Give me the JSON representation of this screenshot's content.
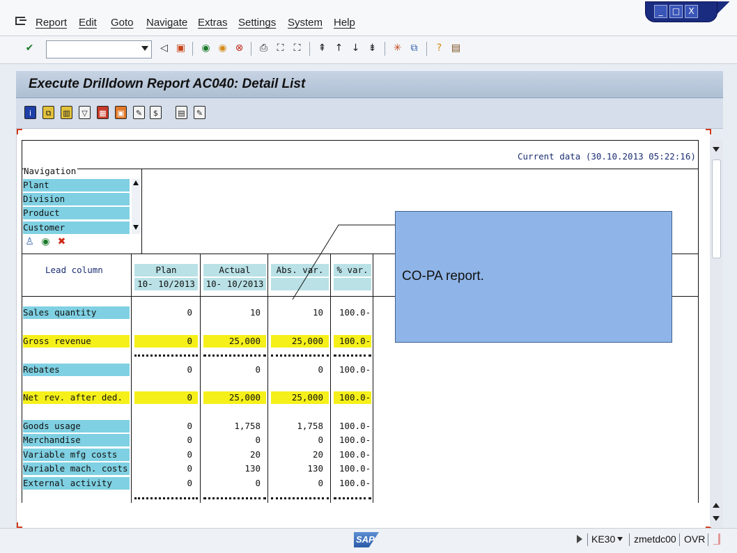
{
  "menu": {
    "items": [
      "Report",
      "Edit",
      "Goto",
      "Navigate",
      "Extras",
      "Settings",
      "System",
      "Help"
    ]
  },
  "window_controls": {
    "minimize": "_",
    "restore": "□",
    "close": "X"
  },
  "toolbar": {
    "command_field": {
      "value": "",
      "placeholder": ""
    },
    "icons": [
      "enter-check-icon",
      "back-icon",
      "save-icon",
      "back-green-icon",
      "exit-icon",
      "cancel-icon",
      "print-icon",
      "find-icon",
      "find-next-icon",
      "first-page-icon",
      "previous-page-icon",
      "next-page-icon",
      "last-page-icon",
      "create-session-icon",
      "shortcut-icon",
      "help-icon",
      "customize-layout-icon"
    ]
  },
  "title": "Execute Drilldown Report AC040: Detail List",
  "app_toolbar": {
    "icons": [
      "info-icon",
      "copy-icon",
      "chart-icon",
      "filter-icon",
      "sort-icon",
      "export-icon",
      "edit-icon",
      "currency-icon",
      "document-icon",
      "change-icon"
    ]
  },
  "report": {
    "current_data": "Current data (30.10.2013 05:22:16)",
    "navigation": {
      "title": "Navigation",
      "items": [
        "Plant",
        "Division",
        "Product",
        "Customer"
      ]
    },
    "columns": {
      "lead": "Lead column",
      "headers": [
        {
          "label": "Plan",
          "sub": "10- 10/2013"
        },
        {
          "label": "Actual",
          "sub": "10- 10/2013"
        },
        {
          "label": "Abs. var.",
          "sub": ""
        },
        {
          "label": "% var.",
          "sub": ""
        }
      ]
    },
    "rows": [
      {
        "label": "Sales quantity",
        "plan": "0",
        "actual": "10",
        "abs": "10",
        "pct": "100.0-"
      },
      {
        "label": "Gross revenue",
        "plan": "0",
        "actual": "25,000",
        "abs": "25,000",
        "pct": "100.0-"
      },
      {
        "label": "Rebates",
        "plan": "0",
        "actual": "0",
        "abs": "0",
        "pct": "100.0-"
      },
      {
        "label": "Net rev. after ded.",
        "plan": "0",
        "actual": "25,000",
        "abs": "25,000",
        "pct": "100.0-"
      },
      {
        "label": "Goods usage",
        "plan": "0",
        "actual": "1,758",
        "abs": "1,758",
        "pct": "100.0-"
      },
      {
        "label": "Merchandise",
        "plan": "0",
        "actual": "0",
        "abs": "0",
        "pct": "100.0-"
      },
      {
        "label": "Variable mfg costs",
        "plan": "0",
        "actual": "20",
        "abs": "20",
        "pct": "100.0-"
      },
      {
        "label": "Variable mach. costs",
        "plan": "0",
        "actual": "130",
        "abs": "130",
        "pct": "100.0-"
      },
      {
        "label": "External activity",
        "plan": "0",
        "actual": "0",
        "abs": "0",
        "pct": "100.0-"
      }
    ]
  },
  "callout": {
    "text": "CO-PA report."
  },
  "status": {
    "logo": "SAP",
    "transaction": "KE30",
    "server": "zmetdc00",
    "mode": "OVR"
  }
}
